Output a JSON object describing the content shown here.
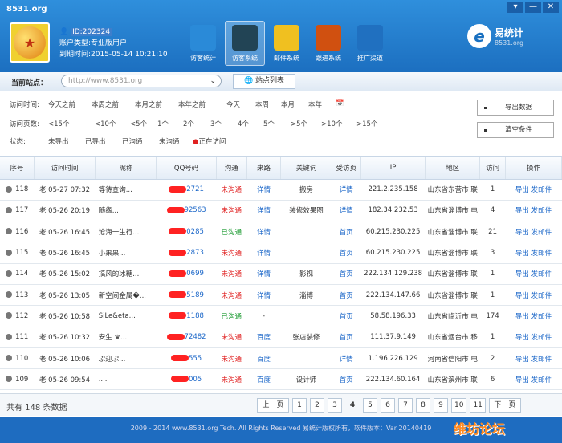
{
  "header": {
    "site": "8531.org",
    "user_id": "ID:202324",
    "account_type": "账户类型:专业版用户",
    "expire": "到期时间:2015-05-14 10:21:10"
  },
  "window_buttons": [
    "▾",
    "—",
    "✕"
  ],
  "nav": [
    {
      "label": "访客统计",
      "icon": "pie-chart-icon",
      "color": "#2a8ad8"
    },
    {
      "label": "访客系统",
      "icon": "address-book-icon",
      "color": "#245"
    },
    {
      "label": "邮件系统",
      "icon": "envelope-icon",
      "color": "#f0c020"
    },
    {
      "label": "跟进系统",
      "icon": "folder-icon",
      "color": "#d05010"
    },
    {
      "label": "推广渠道",
      "icon": "globe-icon",
      "color": "#2070c0"
    }
  ],
  "logo": {
    "title": "易统计",
    "sub": "8531.org"
  },
  "station": {
    "label": "当前站点：",
    "value": "http://www.8531.org",
    "button": "站点列表"
  },
  "filters": {
    "time_label": "访问时间:",
    "time_opts": [
      "今天之前",
      "本周之前",
      "本月之前",
      "本年之前",
      "今天",
      "本周",
      "本月",
      "本年"
    ],
    "pages_label": "访问页数:",
    "pages_opts": [
      "<15个",
      "<10个",
      "<5个",
      "1个",
      "2个",
      "3个",
      "4个",
      "5个",
      ">5个",
      ">10个",
      ">15个"
    ],
    "status_label": "状态:",
    "status_opts": [
      "未导出",
      "已导出",
      "已沟通",
      "未沟通",
      "正在访问"
    ],
    "export_btn": "导出数据",
    "clear_btn": "清空条件"
  },
  "table": {
    "columns": [
      "序号",
      "访问时间",
      "昵称",
      "QQ号码",
      "沟通",
      "来路",
      "关键词",
      "受访页",
      "IP",
      "地区",
      "访问",
      "操作"
    ],
    "rows": [
      {
        "no": "118",
        "time": "老 05-27 07:32",
        "nick": "等待查询...",
        "qq": "2721",
        "comm": "未沟通",
        "src": "详情",
        "kw": "搬房",
        "page": "详情",
        "ip": "221.2.235.158",
        "area": "山东省东营市 联",
        "visits": "1",
        "ops": "导出 发邮件"
      },
      {
        "no": "117",
        "time": "老 05-26 20:19",
        "nick": "随缘...",
        "qq": "92563",
        "comm": "未沟通",
        "src": "详情",
        "kw": "装修效果图",
        "page": "详情",
        "ip": "182.34.232.53",
        "area": "山东省淄博市 电",
        "visits": "4",
        "ops": "导出 发邮件"
      },
      {
        "no": "116",
        "time": "老 05-26 16:45",
        "nick": "沧海一生行...",
        "qq": "0285",
        "comm": "已沟通",
        "src": "详情",
        "kw": "",
        "page": "首页",
        "ip": "60.215.230.225",
        "area": "山东省淄博市 联",
        "visits": "21",
        "ops": "导出 发邮件"
      },
      {
        "no": "115",
        "time": "老 05-26 16:45",
        "nick": "小果果...",
        "qq": "2873",
        "comm": "未沟通",
        "src": "详情",
        "kw": "",
        "page": "首页",
        "ip": "60.215.230.225",
        "area": "山东省淄博市 联",
        "visits": "3",
        "ops": "导出 发邮件"
      },
      {
        "no": "114",
        "time": "老 05-26 15:02",
        "nick": "搞风的冰糖...",
        "qq": "0699",
        "comm": "未沟通",
        "src": "详情",
        "kw": "影视",
        "page": "首页",
        "ip": "222.134.129.238",
        "area": "山东省淄博市 联",
        "visits": "1",
        "ops": "导出 发邮件"
      },
      {
        "no": "113",
        "time": "老 05-26 13:05",
        "nick": "新空间金属�...",
        "qq": "5189",
        "comm": "未沟通",
        "src": "详情",
        "kw": "淄博",
        "page": "首页",
        "ip": "222.134.147.66",
        "area": "山东省淄博市 联",
        "visits": "1",
        "ops": "导出 发邮件"
      },
      {
        "no": "112",
        "time": "老 05-26 10:58",
        "nick": "SiLe&eta...",
        "qq": "1188",
        "comm": "已沟通",
        "src": "-",
        "kw": "",
        "page": "首页",
        "ip": "58.58.196.33",
        "area": "山东省临沂市 电",
        "visits": "174",
        "ops": "导出 发邮件"
      },
      {
        "no": "111",
        "time": "老 05-26 10:32",
        "nick": "安生 ♛...",
        "qq": "72482",
        "comm": "未沟通",
        "src": "百度",
        "kw": "张店装修",
        "page": "首页",
        "ip": "111.37.9.149",
        "area": "山东省烟台市 移",
        "visits": "1",
        "ops": "导出 发邮件"
      },
      {
        "no": "110",
        "time": "老 05-26 10:06",
        "nick": "ぷ迎ぷ...",
        "qq": "555",
        "comm": "未沟通",
        "src": "百度",
        "kw": "",
        "page": "详情",
        "ip": "1.196.226.129",
        "area": "河南省信阳市 电",
        "visits": "2",
        "ops": "导出 发邮件"
      },
      {
        "no": "109",
        "time": "老 05-26 09:54",
        "nick": "....",
        "qq": "005",
        "comm": "未沟通",
        "src": "百度",
        "kw": "设计师",
        "page": "首页",
        "ip": "222.134.60.164",
        "area": "山东省滨州市 联",
        "visits": "6",
        "ops": "导出 发邮件"
      }
    ]
  },
  "pager": {
    "total": "共有  148  条数据",
    "prev": "上一页",
    "pages": [
      "1",
      "2",
      "3",
      "4",
      "5",
      "6",
      "7",
      "8",
      "9",
      "10",
      "11"
    ],
    "current": "4",
    "next": "下一页"
  },
  "footer": "2009 - 2014 www.8531.org Tech. All Rights Reserved 易统计版权所有，软件版本：Var 20140419",
  "watermark": "维坊论坛"
}
